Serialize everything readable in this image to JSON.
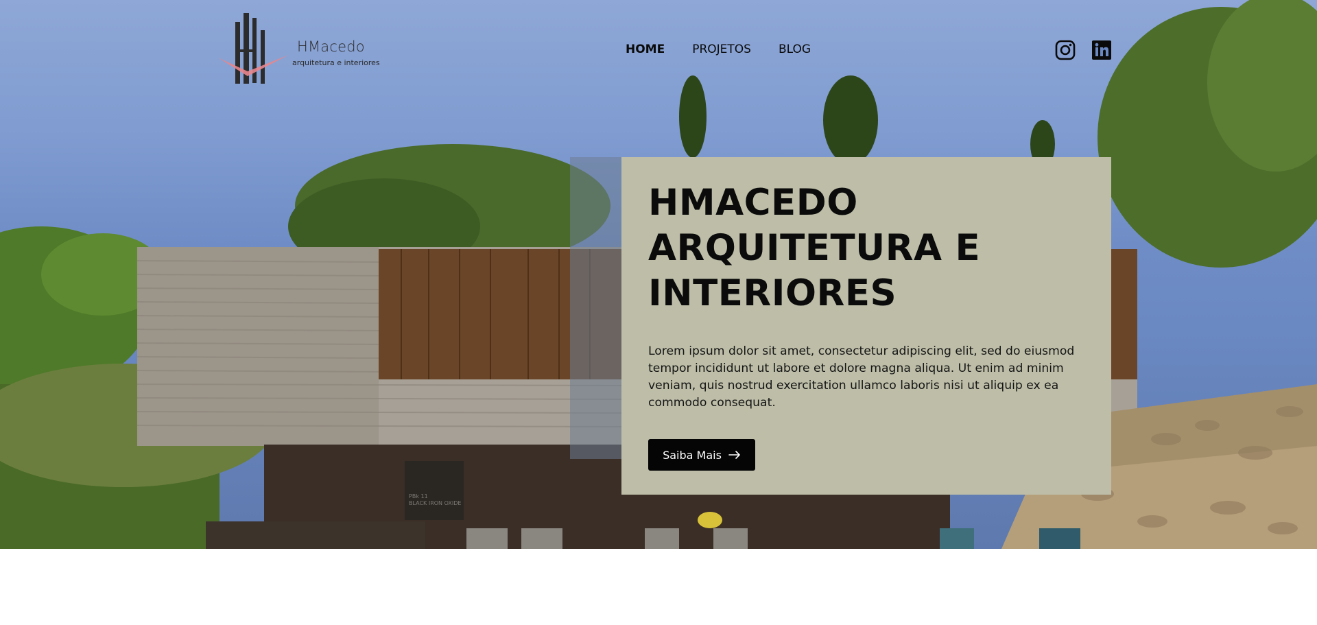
{
  "brand": {
    "name": "HMacedo",
    "tagline": "arquitetura e interiores"
  },
  "nav": {
    "items": [
      {
        "label": "HOME",
        "active": true
      },
      {
        "label": "PROJETOS",
        "active": false
      },
      {
        "label": "BLOG",
        "active": false
      }
    ]
  },
  "social": {
    "icons": [
      "instagram-icon",
      "linkedin-icon"
    ]
  },
  "hero": {
    "headline": "HMACEDO ARQUITETURA E INTERIORES",
    "body": "Lorem ipsum dolor sit amet, consectetur adipiscing elit, sed do eiusmod tempor incididunt ut labore et dolore magna aliqua. Ut enim ad minim veniam, quis nostrud exercitation ullamco laboris nisi ut aliquip ex ea commodo consequat.",
    "cta_label": "Saiba Mais",
    "background_sign": "PBk 11\nBLACK IRON OXIDE"
  },
  "colors": {
    "content_box": "#bdbda8",
    "button": "#050505",
    "logo_accent": "#e8868d"
  }
}
